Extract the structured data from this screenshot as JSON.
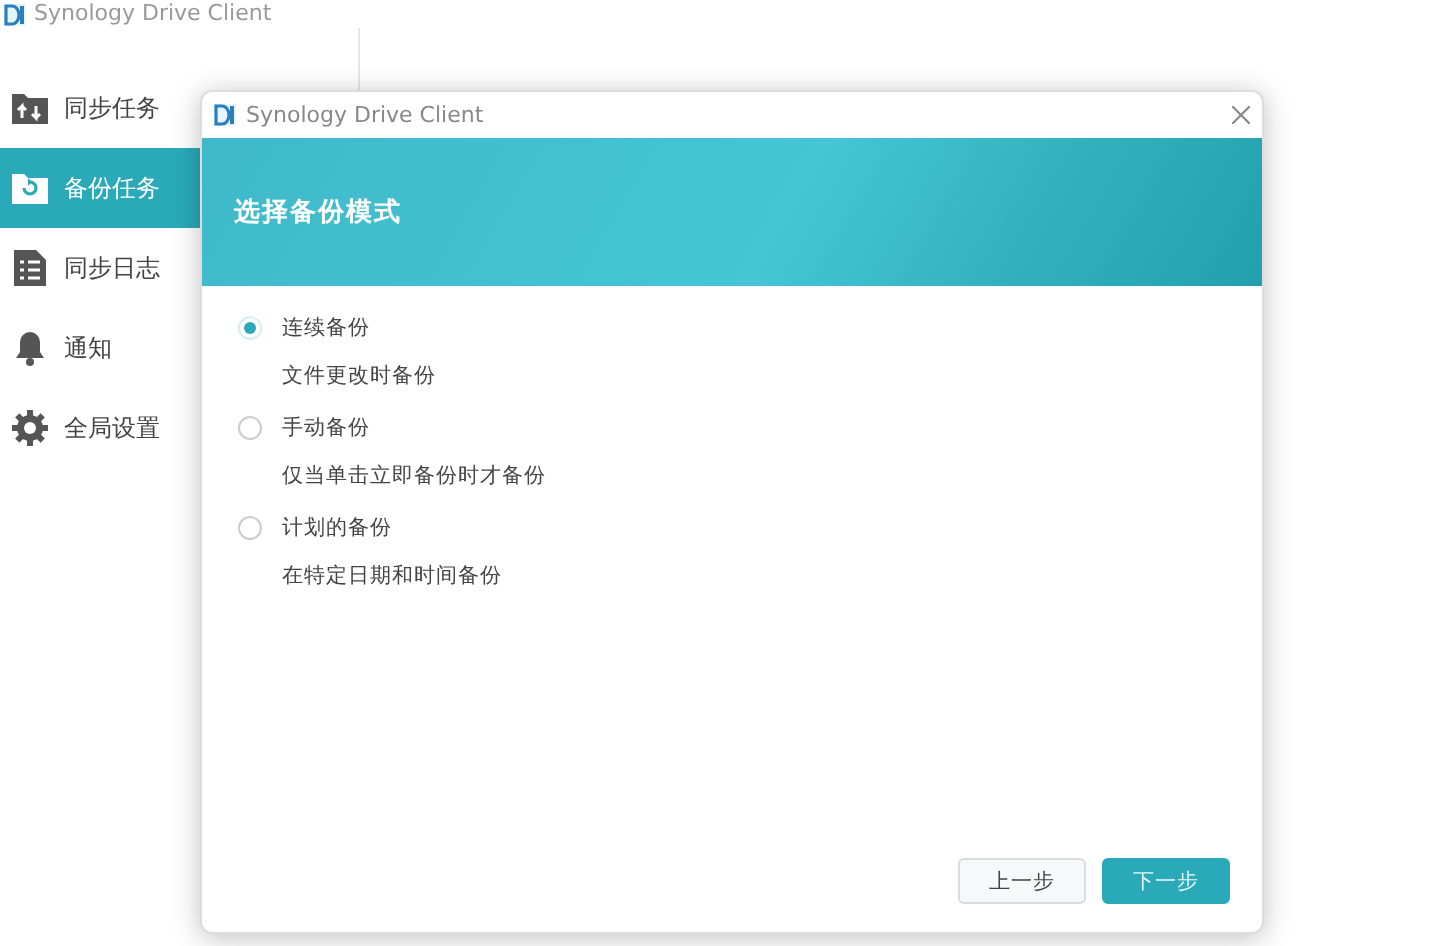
{
  "main_window": {
    "title": "Synology Drive Client"
  },
  "sidebar": {
    "items": [
      {
        "label": "同步任务",
        "selected": false
      },
      {
        "label": "备份任务",
        "selected": true
      },
      {
        "label": "同步日志",
        "selected": false
      },
      {
        "label": "通知",
        "selected": false
      },
      {
        "label": "全局设置",
        "selected": false
      }
    ]
  },
  "dialog": {
    "title": "Synology Drive Client",
    "heading": "选择备份模式",
    "options": [
      {
        "label": "连续备份",
        "description": "文件更改时备份",
        "selected": true
      },
      {
        "label": "手动备份",
        "description": "仅当单击立即备份时才备份",
        "selected": false
      },
      {
        "label": "计划的备份",
        "description": "在特定日期和时间备份",
        "selected": false
      }
    ],
    "buttons": [
      {
        "label": "上一步",
        "kind": "secondary"
      },
      {
        "label": "下一步",
        "kind": "primary"
      }
    ]
  }
}
